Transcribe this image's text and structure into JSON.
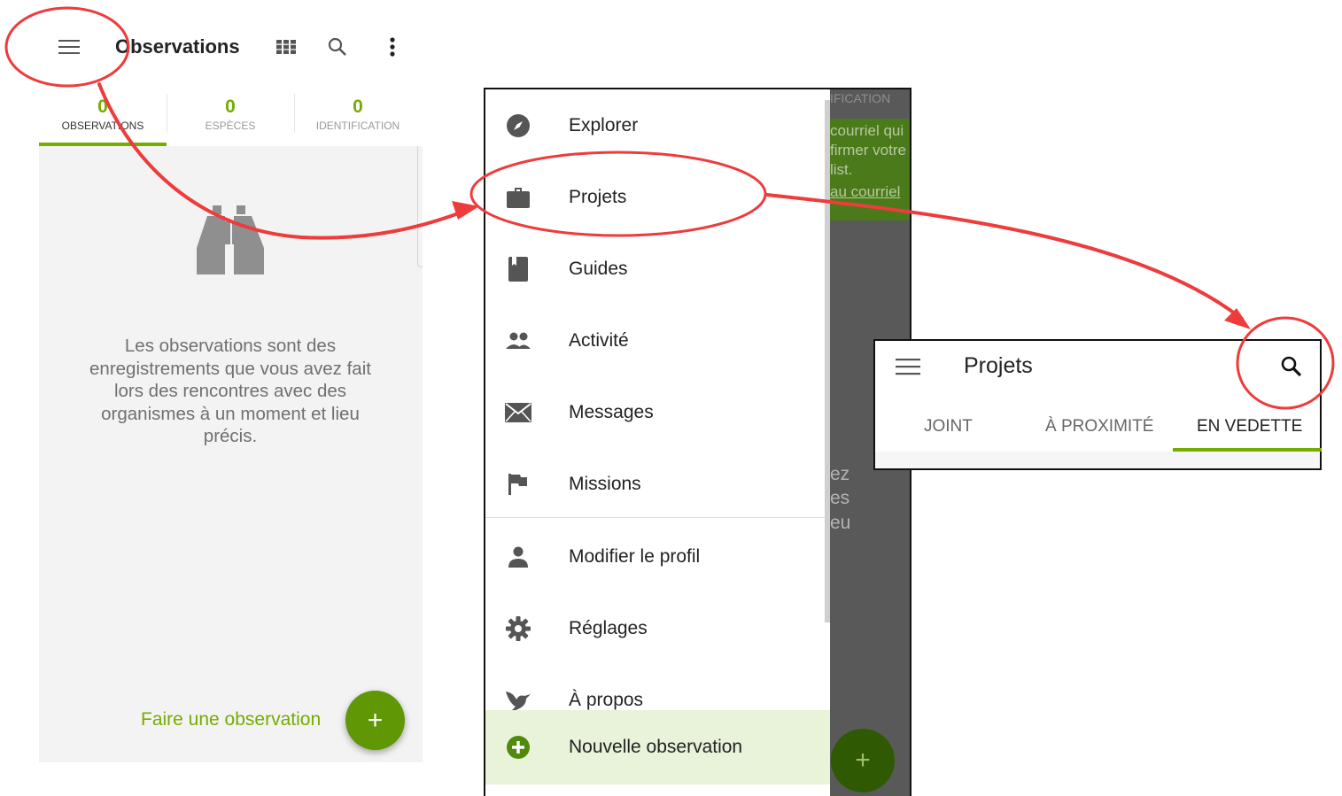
{
  "colors": {
    "accent": "#74ac00",
    "annotation": "#ee3b3b"
  },
  "observations_screen": {
    "title": "Observations",
    "menu_icon": "hamburger-menu-icon",
    "grid_icon": "grid-view-icon",
    "search_icon": "search-icon",
    "more_icon": "more-vert-icon",
    "tabs": [
      {
        "count": "0",
        "label": "OBSERVATIONS"
      },
      {
        "count": "0",
        "label": "ESPÈCES"
      },
      {
        "count": "0",
        "label": "IDENTIFICATION"
      }
    ],
    "empty_text": "Les observations sont des enregistrements que vous avez fait lors des rencontres avec des organismes à un moment et lieu précis.",
    "cta_label": "Faire une observation",
    "fab_symbol": "+"
  },
  "drawer": {
    "items": [
      {
        "icon": "compass-icon",
        "label": "Explorer"
      },
      {
        "icon": "briefcase-icon",
        "label": "Projets"
      },
      {
        "icon": "book-icon",
        "label": "Guides"
      },
      {
        "icon": "people-icon",
        "label": "Activité"
      },
      {
        "icon": "mail-icon",
        "label": "Messages"
      },
      {
        "icon": "flag-icon",
        "label": "Missions"
      },
      {
        "icon": "person-icon",
        "label": "Modifier le profil"
      },
      {
        "icon": "gear-icon",
        "label": "Réglages"
      },
      {
        "icon": "bird-icon",
        "label": "À propos"
      },
      {
        "icon": "add-circle-icon",
        "label": "Nouvelle observation"
      }
    ],
    "background_fragments": {
      "header_fragment": "IFICATION",
      "notice_line1": "courriel qui",
      "notice_line2": "firmer votre",
      "notice_line3": "list.",
      "notice_link": "au courriel",
      "body_line1": "ez",
      "body_line2": "es",
      "body_line3": "eu"
    },
    "fab_symbol": "+"
  },
  "projects_screen": {
    "title": "Projets",
    "menu_icon": "hamburger-menu-icon",
    "search_icon": "search-icon",
    "tabs": [
      "JOINT",
      "À PROXIMITÉ",
      "EN VEDETTE"
    ],
    "active_tab": "EN VEDETTE"
  }
}
